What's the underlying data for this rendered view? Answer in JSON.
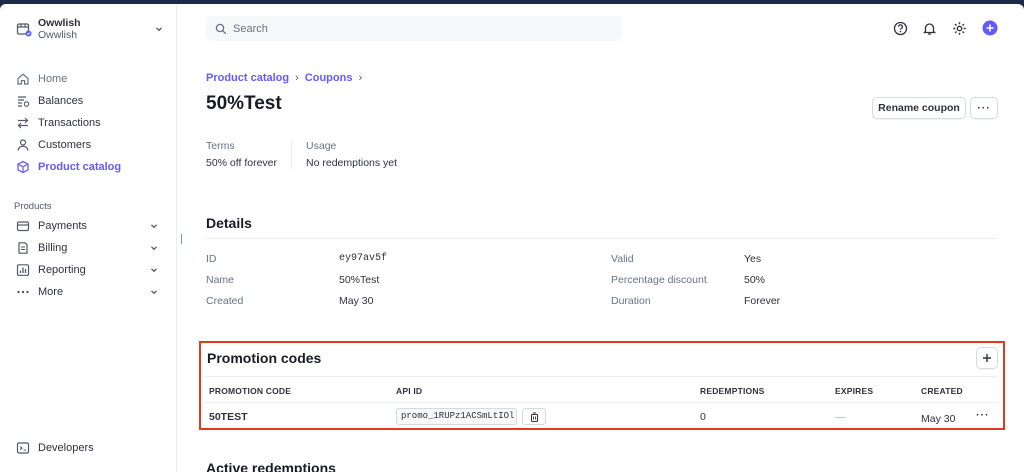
{
  "account": {
    "name": "Owwlish",
    "sub": "Owwlish"
  },
  "sidebar": {
    "primary": [
      {
        "label": "Home",
        "icon": "home-icon"
      },
      {
        "label": "Balances",
        "icon": "balances-icon"
      },
      {
        "label": "Transactions",
        "icon": "transactions-icon"
      },
      {
        "label": "Customers",
        "icon": "customers-icon"
      },
      {
        "label": "Product catalog",
        "icon": "product-catalog-icon"
      }
    ],
    "section_label": "Products",
    "products": [
      {
        "label": "Payments",
        "icon": "payments-icon"
      },
      {
        "label": "Billing",
        "icon": "billing-icon"
      },
      {
        "label": "Reporting",
        "icon": "reporting-icon"
      },
      {
        "label": "More",
        "icon": "more-icon"
      }
    ],
    "developers": "Developers"
  },
  "search": {
    "placeholder": "Search"
  },
  "breadcrumb": {
    "items": [
      "Product catalog",
      "Coupons"
    ]
  },
  "page": {
    "title": "50%Test",
    "rename_label": "Rename coupon",
    "more_label": "···"
  },
  "summary": {
    "terms_label": "Terms",
    "terms_value": "50% off forever",
    "usage_label": "Usage",
    "usage_value": "No redemptions yet"
  },
  "details": {
    "title": "Details",
    "left": [
      {
        "label": "ID",
        "value": "ey97av5f"
      },
      {
        "label": "Name",
        "value": "50%Test"
      },
      {
        "label": "Created",
        "value": "May 30"
      }
    ],
    "right": [
      {
        "label": "Valid",
        "value": "Yes"
      },
      {
        "label": "Percentage discount",
        "value": "50%"
      },
      {
        "label": "Duration",
        "value": "Forever"
      }
    ]
  },
  "promotion_codes": {
    "title": "Promotion codes",
    "add_label": "+",
    "columns": [
      "PROMOTION CODE",
      "API ID",
      "REDEMPTIONS",
      "EXPIRES",
      "CREATED"
    ],
    "rows": [
      {
        "code": "50TEST",
        "api_id": "promo_1RUPz1ACSmLtIOl",
        "redemptions": "0",
        "expires": "—",
        "created": "May 30",
        "more": "···"
      }
    ]
  },
  "active_redemptions": {
    "title": "Active redemptions"
  },
  "colors": {
    "accent": "#635bff",
    "highlight_border": "#e03a1f"
  }
}
